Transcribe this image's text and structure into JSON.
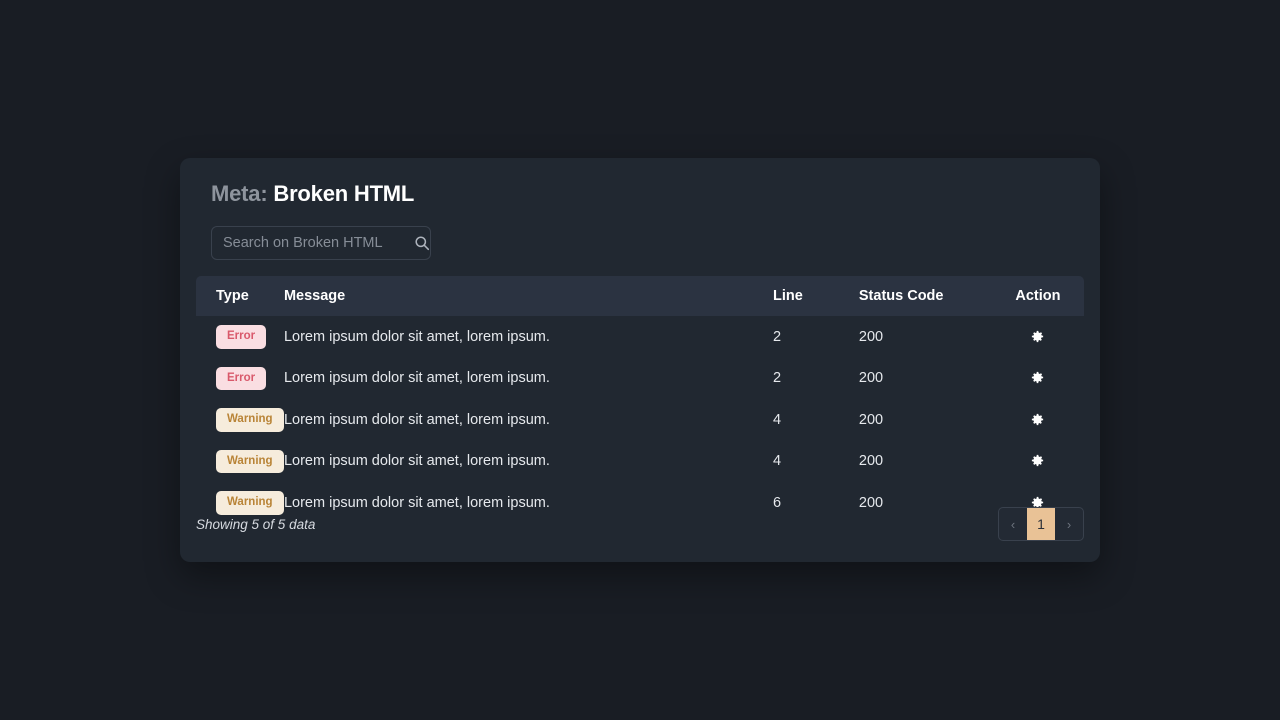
{
  "page": {
    "background_color": "#191d24",
    "card_background_color": "#212831"
  },
  "header": {
    "meta_label": "Meta:",
    "meta_value": "Broken HTML",
    "title_full": "Meta: Broken HTML"
  },
  "search": {
    "placeholder": "Search on Broken HTML",
    "value": "",
    "icon": "search-icon"
  },
  "table": {
    "columns": [
      {
        "key": "type",
        "label": "Type"
      },
      {
        "key": "message",
        "label": "Message"
      },
      {
        "key": "line",
        "label": "Line"
      },
      {
        "key": "status",
        "label": "Status Code"
      },
      {
        "key": "action",
        "label": "Action"
      }
    ],
    "rows": [
      {
        "type": "Error",
        "type_variant": "error",
        "message": "Lorem ipsum dolor sit amet, lorem ipsum.",
        "line": "2",
        "status": "200",
        "action_icon": "gear-icon"
      },
      {
        "type": "Error",
        "type_variant": "error",
        "message": "Lorem ipsum dolor sit amet, lorem ipsum.",
        "line": "2",
        "status": "200",
        "action_icon": "gear-icon"
      },
      {
        "type": "Warning",
        "type_variant": "warning",
        "message": "Lorem ipsum dolor sit amet, lorem ipsum.",
        "line": "4",
        "status": "200",
        "action_icon": "gear-icon"
      },
      {
        "type": "Warning",
        "type_variant": "warning",
        "message": "Lorem ipsum dolor sit amet, lorem ipsum.",
        "line": "4",
        "status": "200",
        "action_icon": "gear-icon"
      },
      {
        "type": "Warning",
        "type_variant": "warning",
        "message": "Lorem ipsum dolor sit amet, lorem ipsum.",
        "line": "6",
        "status": "200",
        "action_icon": "gear-icon"
      }
    ]
  },
  "footer": {
    "showing_text": "Showing 5 of 5 data",
    "pagination": {
      "prev_label": "‹",
      "next_label": "›",
      "current_page": "1",
      "active_color": "#e9c296"
    }
  },
  "badge_colors": {
    "error_bg": "#fadee2",
    "error_text": "#d9596b",
    "warning_bg": "#f6ecdc",
    "warning_text": "#b98437"
  }
}
